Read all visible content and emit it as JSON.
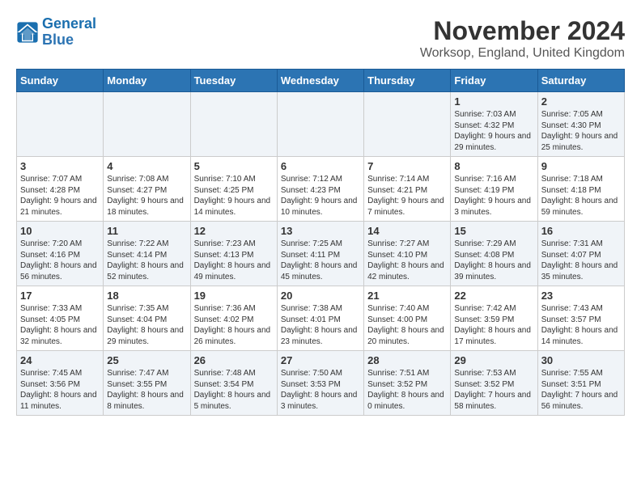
{
  "header": {
    "logo_line1": "General",
    "logo_line2": "Blue",
    "title": "November 2024",
    "subtitle": "Worksop, England, United Kingdom"
  },
  "days_of_week": [
    "Sunday",
    "Monday",
    "Tuesday",
    "Wednesday",
    "Thursday",
    "Friday",
    "Saturday"
  ],
  "weeks": [
    [
      {
        "day": "",
        "info": ""
      },
      {
        "day": "",
        "info": ""
      },
      {
        "day": "",
        "info": ""
      },
      {
        "day": "",
        "info": ""
      },
      {
        "day": "",
        "info": ""
      },
      {
        "day": "1",
        "info": "Sunrise: 7:03 AM\nSunset: 4:32 PM\nDaylight: 9 hours and 29 minutes."
      },
      {
        "day": "2",
        "info": "Sunrise: 7:05 AM\nSunset: 4:30 PM\nDaylight: 9 hours and 25 minutes."
      }
    ],
    [
      {
        "day": "3",
        "info": "Sunrise: 7:07 AM\nSunset: 4:28 PM\nDaylight: 9 hours and 21 minutes."
      },
      {
        "day": "4",
        "info": "Sunrise: 7:08 AM\nSunset: 4:27 PM\nDaylight: 9 hours and 18 minutes."
      },
      {
        "day": "5",
        "info": "Sunrise: 7:10 AM\nSunset: 4:25 PM\nDaylight: 9 hours and 14 minutes."
      },
      {
        "day": "6",
        "info": "Sunrise: 7:12 AM\nSunset: 4:23 PM\nDaylight: 9 hours and 10 minutes."
      },
      {
        "day": "7",
        "info": "Sunrise: 7:14 AM\nSunset: 4:21 PM\nDaylight: 9 hours and 7 minutes."
      },
      {
        "day": "8",
        "info": "Sunrise: 7:16 AM\nSunset: 4:19 PM\nDaylight: 9 hours and 3 minutes."
      },
      {
        "day": "9",
        "info": "Sunrise: 7:18 AM\nSunset: 4:18 PM\nDaylight: 8 hours and 59 minutes."
      }
    ],
    [
      {
        "day": "10",
        "info": "Sunrise: 7:20 AM\nSunset: 4:16 PM\nDaylight: 8 hours and 56 minutes."
      },
      {
        "day": "11",
        "info": "Sunrise: 7:22 AM\nSunset: 4:14 PM\nDaylight: 8 hours and 52 minutes."
      },
      {
        "day": "12",
        "info": "Sunrise: 7:23 AM\nSunset: 4:13 PM\nDaylight: 8 hours and 49 minutes."
      },
      {
        "day": "13",
        "info": "Sunrise: 7:25 AM\nSunset: 4:11 PM\nDaylight: 8 hours and 45 minutes."
      },
      {
        "day": "14",
        "info": "Sunrise: 7:27 AM\nSunset: 4:10 PM\nDaylight: 8 hours and 42 minutes."
      },
      {
        "day": "15",
        "info": "Sunrise: 7:29 AM\nSunset: 4:08 PM\nDaylight: 8 hours and 39 minutes."
      },
      {
        "day": "16",
        "info": "Sunrise: 7:31 AM\nSunset: 4:07 PM\nDaylight: 8 hours and 35 minutes."
      }
    ],
    [
      {
        "day": "17",
        "info": "Sunrise: 7:33 AM\nSunset: 4:05 PM\nDaylight: 8 hours and 32 minutes."
      },
      {
        "day": "18",
        "info": "Sunrise: 7:35 AM\nSunset: 4:04 PM\nDaylight: 8 hours and 29 minutes."
      },
      {
        "day": "19",
        "info": "Sunrise: 7:36 AM\nSunset: 4:02 PM\nDaylight: 8 hours and 26 minutes."
      },
      {
        "day": "20",
        "info": "Sunrise: 7:38 AM\nSunset: 4:01 PM\nDaylight: 8 hours and 23 minutes."
      },
      {
        "day": "21",
        "info": "Sunrise: 7:40 AM\nSunset: 4:00 PM\nDaylight: 8 hours and 20 minutes."
      },
      {
        "day": "22",
        "info": "Sunrise: 7:42 AM\nSunset: 3:59 PM\nDaylight: 8 hours and 17 minutes."
      },
      {
        "day": "23",
        "info": "Sunrise: 7:43 AM\nSunset: 3:57 PM\nDaylight: 8 hours and 14 minutes."
      }
    ],
    [
      {
        "day": "24",
        "info": "Sunrise: 7:45 AM\nSunset: 3:56 PM\nDaylight: 8 hours and 11 minutes."
      },
      {
        "day": "25",
        "info": "Sunrise: 7:47 AM\nSunset: 3:55 PM\nDaylight: 8 hours and 8 minutes."
      },
      {
        "day": "26",
        "info": "Sunrise: 7:48 AM\nSunset: 3:54 PM\nDaylight: 8 hours and 5 minutes."
      },
      {
        "day": "27",
        "info": "Sunrise: 7:50 AM\nSunset: 3:53 PM\nDaylight: 8 hours and 3 minutes."
      },
      {
        "day": "28",
        "info": "Sunrise: 7:51 AM\nSunset: 3:52 PM\nDaylight: 8 hours and 0 minutes."
      },
      {
        "day": "29",
        "info": "Sunrise: 7:53 AM\nSunset: 3:52 PM\nDaylight: 7 hours and 58 minutes."
      },
      {
        "day": "30",
        "info": "Sunrise: 7:55 AM\nSunset: 3:51 PM\nDaylight: 7 hours and 56 minutes."
      }
    ]
  ]
}
